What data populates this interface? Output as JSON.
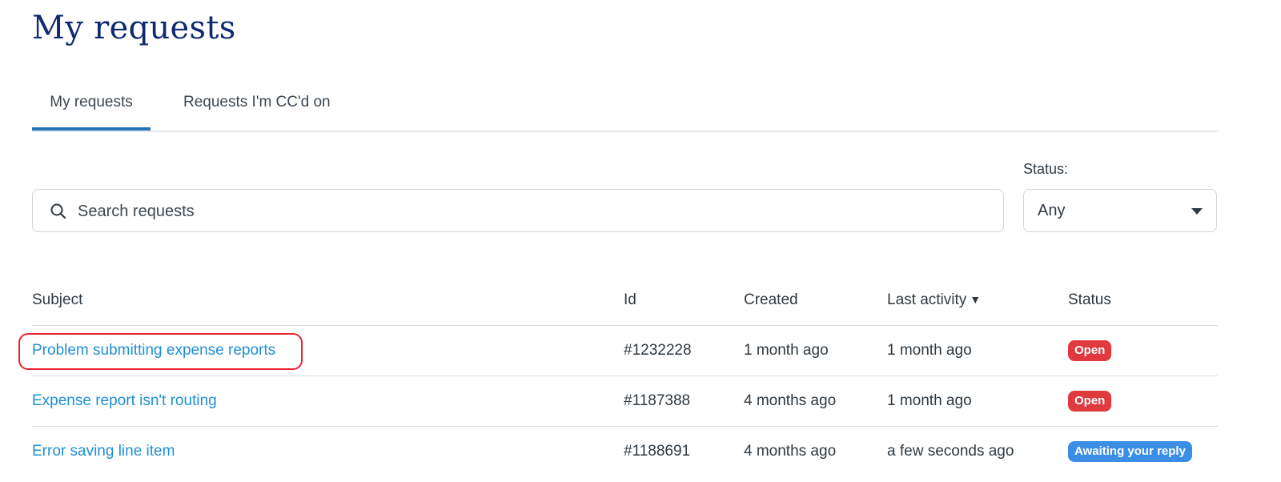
{
  "page": {
    "title": "My requests"
  },
  "tabs": [
    {
      "label": "My requests",
      "active": true
    },
    {
      "label": "Requests I'm CC'd on",
      "active": false
    }
  ],
  "filters": {
    "search": {
      "placeholder": "Search requests",
      "value": "",
      "icon": "search-icon"
    },
    "status": {
      "label": "Status:",
      "selected": "Any",
      "icon": "chevron-down-icon"
    }
  },
  "table": {
    "columns": {
      "subject": "Subject",
      "id": "Id",
      "created": "Created",
      "last_activity": "Last activity",
      "last_activity_sort": "▼",
      "status": "Status"
    },
    "rows": [
      {
        "subject": "Problem submitting expense reports",
        "id": "#1232228",
        "created": "1 month ago",
        "last_activity": "1 month ago",
        "status": "Open",
        "highlighted": true
      },
      {
        "subject": "Expense report isn't routing",
        "id": "#1187388",
        "created": "4 months ago",
        "last_activity": "1 month ago",
        "status": "Open",
        "highlighted": false
      },
      {
        "subject": "Error saving line item",
        "id": "#1188691",
        "created": "4 months ago",
        "last_activity": "a few seconds ago",
        "status": "Awaiting your reply",
        "highlighted": false
      }
    ]
  },
  "colors": {
    "title": "#0f2a6e",
    "link": "#1f8fd6",
    "tab_active_underline": "#1f73b7",
    "badge_open": "#e0393e",
    "badge_awaiting": "#3a8ee6",
    "highlight": "#e8252b"
  }
}
